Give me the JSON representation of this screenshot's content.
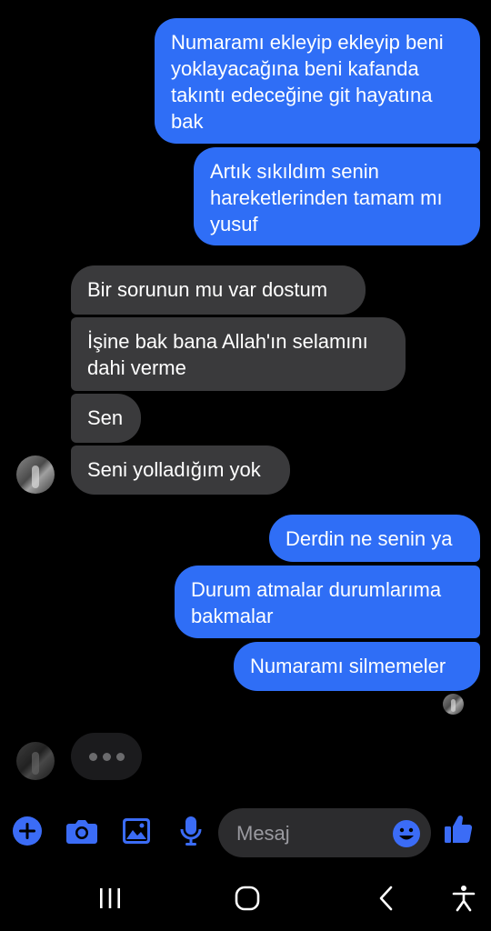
{
  "messages": [
    {
      "text": "Numaramı ekleyip ekleyip beni yoklayacağına beni kafanda takıntı edeceğine git hayatına bak",
      "direction": "out"
    },
    {
      "text": "Artık sıkıldım senin hareketlerinden tamam mı yusuf",
      "direction": "out"
    },
    {
      "text": "Bir sorunun mu var dostum",
      "direction": "in"
    },
    {
      "text": "İşine bak bana Allah'ın selamını dahi verme",
      "direction": "in"
    },
    {
      "text": "Sen",
      "direction": "in"
    },
    {
      "text": "Seni yolladığım yok",
      "direction": "in"
    },
    {
      "text": "Derdin ne senin ya",
      "direction": "out"
    },
    {
      "text": "Durum atmalar durumlarıma bakmalar",
      "direction": "out"
    },
    {
      "text": "Numaramı silmemeler",
      "direction": "out"
    }
  ],
  "composer": {
    "placeholder": "Mesaj",
    "icons": [
      "plus-icon",
      "camera-icon",
      "image-icon",
      "microphone-icon",
      "emoji-icon",
      "thumbs-up-icon"
    ]
  },
  "navbar": {
    "icons": [
      "recent-apps-icon",
      "home-icon",
      "back-icon",
      "accessibility-icon"
    ]
  },
  "colors": {
    "outgoing_bubble": "#2f6ef6",
    "incoming_bubble": "#3a3a3c",
    "accent": "#3b6cf6",
    "background": "#000000"
  }
}
